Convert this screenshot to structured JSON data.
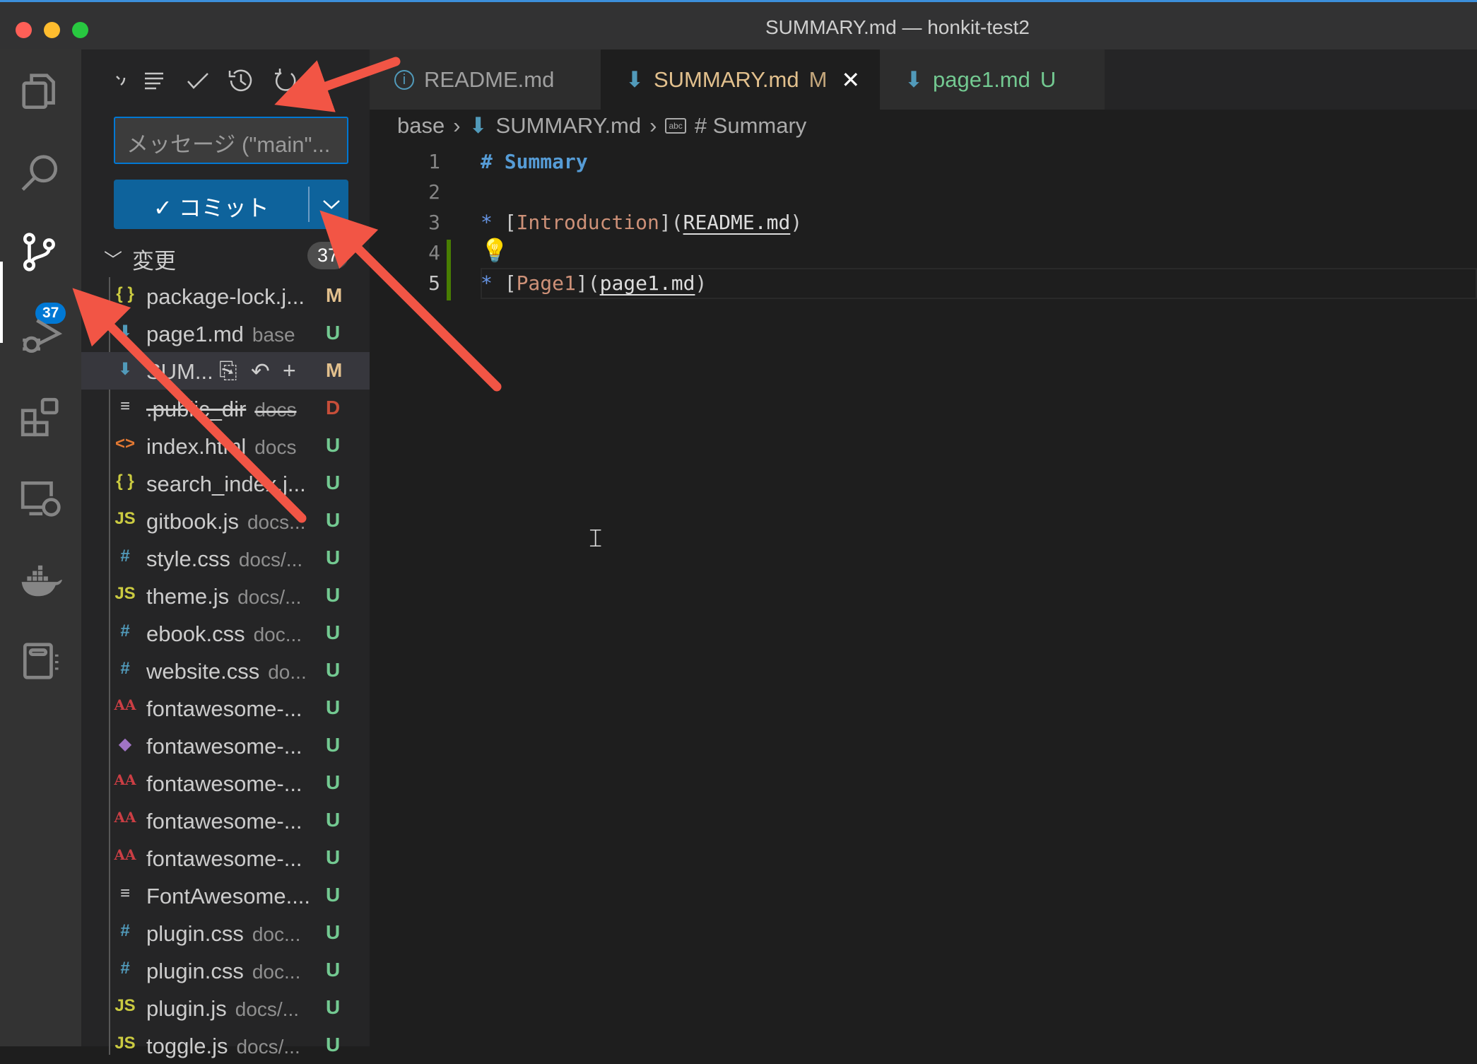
{
  "window": {
    "title": "SUMMARY.md — honkit-test2"
  },
  "colors": {
    "accent": "#0078d4",
    "modified": "#e2c08d",
    "untracked": "#73c991",
    "deleted": "#c74e39",
    "annotation": "#f25545"
  },
  "activity_bar": {
    "items": [
      "explorer-icon",
      "search-icon",
      "source-control-icon",
      "run-debug-icon",
      "extensions-icon",
      "remote-explorer-icon",
      "docker-icon",
      "notebook-icon"
    ],
    "scm_badge": "37"
  },
  "scm": {
    "toolbar_icons": [
      "more-icon",
      "list-view-icon",
      "commit-check-icon",
      "history-icon",
      "refresh-icon"
    ],
    "message_placeholder": "メッセージ (\"main\"...",
    "commit_label": "✓ コミット",
    "changes_label": "変更",
    "changes_count": "37",
    "files": [
      {
        "icon": "{ }",
        "icolor": "#cbcb41",
        "name": "package-lock.j...",
        "dir": "",
        "status": "M"
      },
      {
        "icon": "⬇",
        "icolor": "#519aba",
        "name": "page1.md",
        "dir": "base",
        "status": "U"
      },
      {
        "icon": "⬇",
        "icolor": "#519aba",
        "name": "SUM...",
        "dir": "",
        "status": "M",
        "selected": true
      },
      {
        "icon": "≡",
        "icolor": "#ccc",
        "name": ".public_dir",
        "dir": "docs",
        "status": "D"
      },
      {
        "icon": "<>",
        "icolor": "#e37933",
        "name": "index.html",
        "dir": "docs",
        "status": "U"
      },
      {
        "icon": "{ }",
        "icolor": "#cbcb41",
        "name": "search_index.j...",
        "dir": "",
        "status": "U"
      },
      {
        "icon": "JS",
        "icolor": "#cbcb41",
        "name": "gitbook.js",
        "dir": "docs...",
        "status": "U"
      },
      {
        "icon": "#",
        "icolor": "#519aba",
        "name": "style.css",
        "dir": "docs/...",
        "status": "U"
      },
      {
        "icon": "JS",
        "icolor": "#cbcb41",
        "name": "theme.js",
        "dir": "docs/...",
        "status": "U"
      },
      {
        "icon": "#",
        "icolor": "#519aba",
        "name": "ebook.css",
        "dir": "doc...",
        "status": "U"
      },
      {
        "icon": "#",
        "icolor": "#519aba",
        "name": "website.css",
        "dir": "do...",
        "status": "U"
      },
      {
        "icon": "AA",
        "icolor": "#cc3e44",
        "name": "fontawesome-...",
        "dir": "",
        "status": "U"
      },
      {
        "icon": "◆",
        "icolor": "#a074c4",
        "name": "fontawesome-...",
        "dir": "",
        "status": "U"
      },
      {
        "icon": "AA",
        "icolor": "#cc3e44",
        "name": "fontawesome-...",
        "dir": "",
        "status": "U"
      },
      {
        "icon": "AA",
        "icolor": "#cc3e44",
        "name": "fontawesome-...",
        "dir": "",
        "status": "U"
      },
      {
        "icon": "AA",
        "icolor": "#cc3e44",
        "name": "fontawesome-...",
        "dir": "",
        "status": "U"
      },
      {
        "icon": "≡",
        "icolor": "#ccc",
        "name": "FontAwesome....",
        "dir": "",
        "status": "U"
      },
      {
        "icon": "#",
        "icolor": "#519aba",
        "name": "plugin.css",
        "dir": "doc...",
        "status": "U"
      },
      {
        "icon": "#",
        "icolor": "#519aba",
        "name": "plugin.css",
        "dir": "doc...",
        "status": "U"
      },
      {
        "icon": "JS",
        "icolor": "#cbcb41",
        "name": "plugin.js",
        "dir": "docs/...",
        "status": "U"
      },
      {
        "icon": "JS",
        "icolor": "#cbcb41",
        "name": "toggle.js",
        "dir": "docs/...",
        "status": "U"
      }
    ]
  },
  "tabs": [
    {
      "label": "README.md",
      "badge": "",
      "color": "#a0a0a0",
      "icon": "info-icon"
    },
    {
      "label": "SUMMARY.md",
      "badge": "M",
      "color": "#e2c08d",
      "icon": "markdown-icon",
      "active": true
    },
    {
      "label": "page1.md",
      "badge": "U",
      "color": "#73c991",
      "icon": "markdown-icon"
    }
  ],
  "breadcrumb": {
    "folder": "base",
    "file": "SUMMARY.md",
    "symbol": "# Summary"
  },
  "editor": {
    "lines": [
      {
        "n": "1",
        "text": "# Summary"
      },
      {
        "n": "2",
        "text": ""
      },
      {
        "n": "3",
        "text": "* [Introduction](README.md)"
      },
      {
        "n": "4",
        "text": ""
      },
      {
        "n": "5",
        "text": "* [Page1](page1.md)"
      }
    ]
  }
}
